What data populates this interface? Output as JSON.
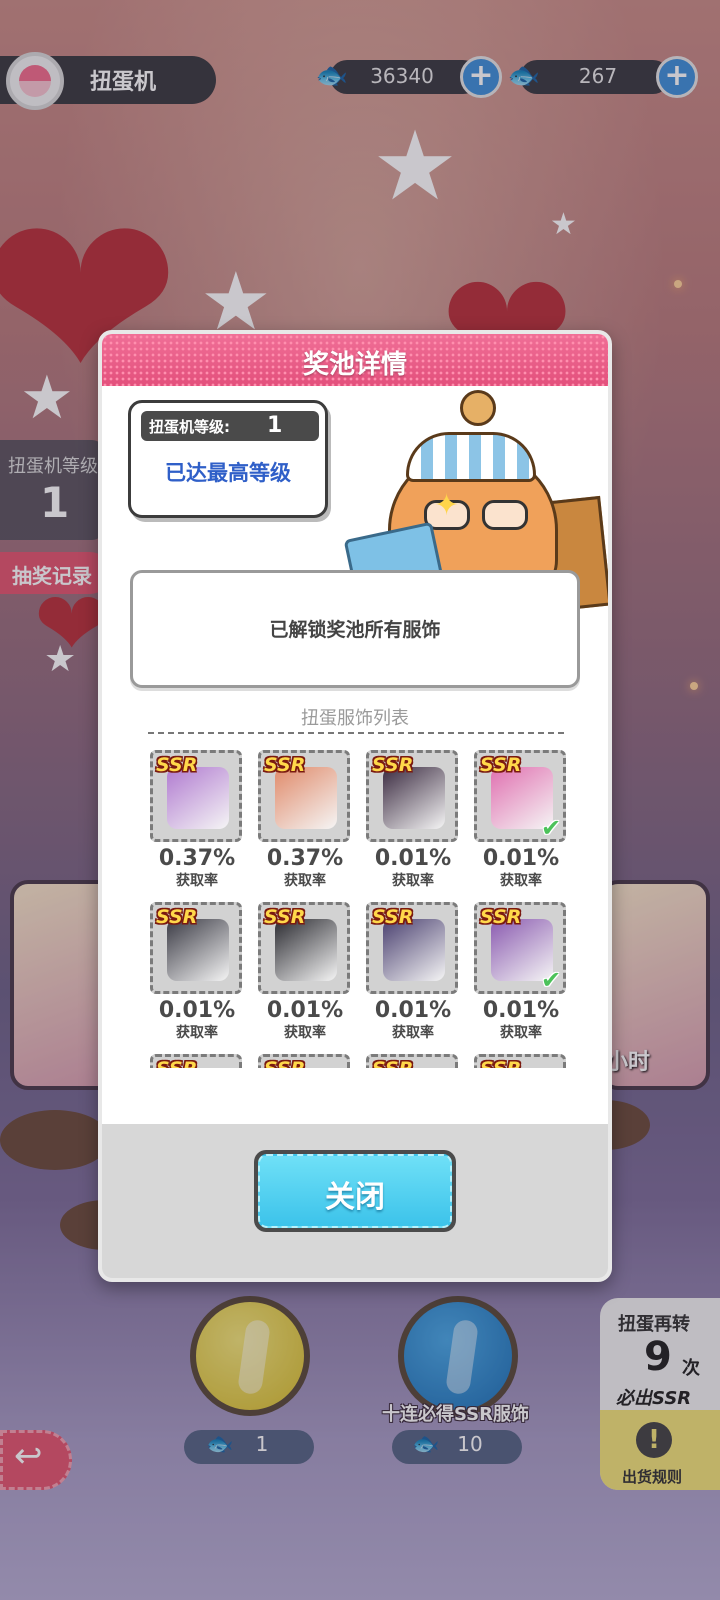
{
  "top_bar": {
    "title": "扭蛋机",
    "currency_a": {
      "icon": "blue-fish-icon",
      "value": "36340"
    },
    "currency_b": {
      "icon": "gold-fish-icon",
      "value": "267"
    }
  },
  "side": {
    "level_label": "扭蛋机等级",
    "level_value": "1",
    "record_label": "抽奖记录",
    "banner_text": "小时"
  },
  "modal": {
    "title": "奖池详情",
    "level_card": {
      "label": "扭蛋机等级:",
      "value": "1",
      "status": "已达最高等级"
    },
    "unlock_message": "已解锁奖池所有服饰",
    "list_title": "扭蛋服饰列表",
    "rate_label": "获取率",
    "items": [
      {
        "badge": "SSR",
        "rate": "0.37%",
        "label": "获取率",
        "icon": "character-card-icon",
        "owned": false,
        "color": "#b07ad0"
      },
      {
        "badge": "SSR",
        "rate": "0.37%",
        "label": "获取率",
        "icon": "character-card-icon",
        "owned": false,
        "color": "#e08a6a"
      },
      {
        "badge": "SSR",
        "rate": "0.01%",
        "label": "获取率",
        "icon": "cat-ear-hat-icon",
        "owned": false,
        "color": "#3a2a40"
      },
      {
        "badge": "SSR",
        "rate": "0.01%",
        "label": "获取率",
        "icon": "jacket-icon",
        "owned": true,
        "color": "#e070b0"
      },
      {
        "badge": "SSR",
        "rate": "0.01%",
        "label": "获取率",
        "icon": "sneakers-icon",
        "owned": false,
        "color": "#3a3a44"
      },
      {
        "badge": "SSR",
        "rate": "0.01%",
        "label": "获取率",
        "icon": "leggings-icon",
        "owned": false,
        "color": "#2a2a30"
      },
      {
        "badge": "SSR",
        "rate": "0.01%",
        "label": "获取率",
        "icon": "beret-icon",
        "owned": false,
        "color": "#4a4070"
      },
      {
        "badge": "SSR",
        "rate": "0.01%",
        "label": "获取率",
        "icon": "flower-hat-icon",
        "owned": true,
        "color": "#8a5ab0"
      },
      {
        "badge": "SSR",
        "rate": "",
        "label": "",
        "icon": "item-icon",
        "owned": false,
        "color": "#999999"
      },
      {
        "badge": "SSR",
        "rate": "",
        "label": "",
        "icon": "item-icon",
        "owned": false,
        "color": "#999999"
      },
      {
        "badge": "SSR",
        "rate": "",
        "label": "",
        "icon": "item-icon",
        "owned": false,
        "color": "#999999"
      },
      {
        "badge": "SSR",
        "rate": "",
        "label": "",
        "icon": "item-icon",
        "owned": false,
        "color": "#999999"
      }
    ],
    "close_label": "关闭"
  },
  "bottom": {
    "single_cost": "1",
    "ten_cost": "10",
    "ten_guarantee": "十连必得SSR服饰",
    "spin_again_label": "扭蛋再转",
    "spin_again_count": "9",
    "spin_again_unit": "次",
    "spin_again_reward": "必出SSR",
    "rules_label": "出货规则"
  },
  "colors": {
    "header_pink": "#e3507c",
    "close_button": "#3cc3ea",
    "level_text": "#2f5fc8",
    "owned_check": "#4cc25a"
  }
}
